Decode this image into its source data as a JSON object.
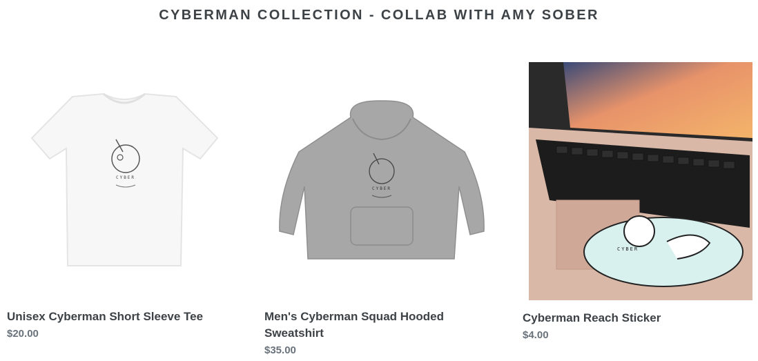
{
  "collection": {
    "title": "CYBERMAN COLLECTION - COLLAB WITH AMY SOBER"
  },
  "products": [
    {
      "name": "Unisex Cyberman Short Sleeve Tee",
      "price": "$20.00",
      "image_icon": "tshirt-image",
      "print_text": "CYBER"
    },
    {
      "name": "Men's Cyberman Squad Hooded Sweatshirt",
      "price": "$35.00",
      "image_icon": "hoodie-image",
      "print_text": "CYBER"
    },
    {
      "name": "Cyberman Reach Sticker",
      "price": "$4.00",
      "image_icon": "laptop-sticker-photo",
      "print_text": "CYBER"
    }
  ],
  "colors": {
    "heading": "#3d4246",
    "price": "#69727b",
    "tee": "#f7f7f7",
    "hoodie": "#a7a7a7",
    "laptop": "#d9b8a8"
  }
}
